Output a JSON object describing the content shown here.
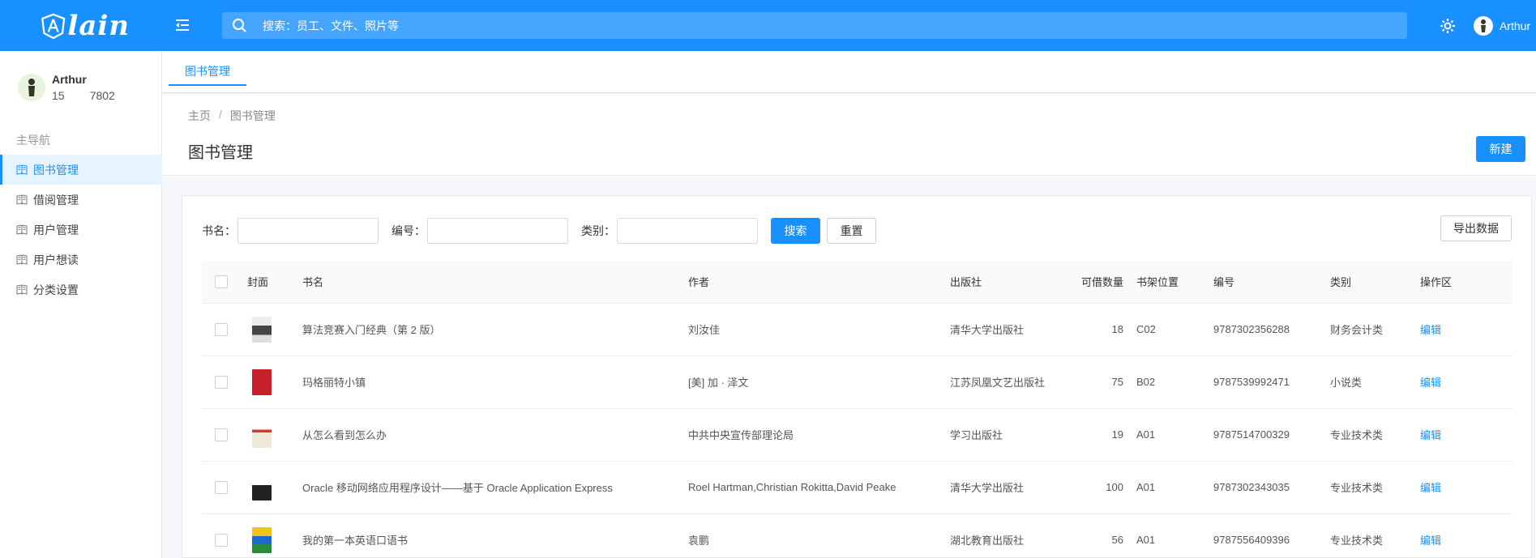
{
  "header": {
    "logo_text": "lain",
    "search_placeholder": "搜索：员工、文件、照片等",
    "user_name": "Arthur"
  },
  "sidebar": {
    "user_name": "Arthur",
    "user_phone": "15        7802",
    "nav_title": "主导航",
    "items": [
      {
        "label": "图书管理",
        "active": true
      },
      {
        "label": "借阅管理"
      },
      {
        "label": "用户管理"
      },
      {
        "label": "用户想读"
      },
      {
        "label": "分类设置"
      }
    ]
  },
  "tab": {
    "label": "图书管理"
  },
  "breadcrumb": {
    "home": "主页",
    "sep": "/",
    "current": "图书管理"
  },
  "page": {
    "title": "图书管理",
    "new_button": "新建"
  },
  "filter": {
    "name_label": "书名：",
    "code_label": "编号：",
    "category_label": "类别：",
    "search_button": "搜索",
    "reset_button": "重置",
    "export_button": "导出数据"
  },
  "table": {
    "headers": [
      "封面",
      "书名",
      "作者",
      "出版社",
      "可借数量",
      "书架位置",
      "编号",
      "类别",
      "操作区"
    ],
    "rows": [
      {
        "title": "算法竞赛入门经典（第 2 版）",
        "author": "刘汝佳",
        "publisher": "清华大学出版社",
        "qty": "18",
        "shelf": "C02",
        "isbn": "9787302356288",
        "category": "财务会计类",
        "action": "编辑",
        "cover_color": "#444444"
      },
      {
        "title": "玛格丽特小镇",
        "author": "[美] 加 · 泽文",
        "publisher": "江苏凤凰文艺出版社",
        "qty": "75",
        "shelf": "B02",
        "isbn": "9787539992471",
        "category": "小说类",
        "action": "编辑",
        "cover_color": "#c8202a"
      },
      {
        "title": "从怎么看到怎么办",
        "author": "中共中央宣传部理论局",
        "publisher": "学习出版社",
        "qty": "19",
        "shelf": "A01",
        "isbn": "9787514700329",
        "category": "专业技术类",
        "action": "编辑",
        "cover_color": "#e8e0d0"
      },
      {
        "title": "Oracle 移动网络应用程序设计——基于 Oracle Application Express",
        "author": "Roel Hartman,Christian Rokitta,David Peake",
        "publisher": "清华大学出版社",
        "qty": "100",
        "shelf": "A01",
        "isbn": "9787302343035",
        "category": "专业技术类",
        "action": "编辑",
        "cover_color": "#222222"
      },
      {
        "title": "我的第一本英语口语书",
        "author": "袁鹏",
        "publisher": "湖北教育出版社",
        "qty": "56",
        "shelf": "A01",
        "isbn": "9787556409396",
        "category": "专业技术类",
        "action": "编辑",
        "cover_color": "#f2c318"
      }
    ]
  }
}
